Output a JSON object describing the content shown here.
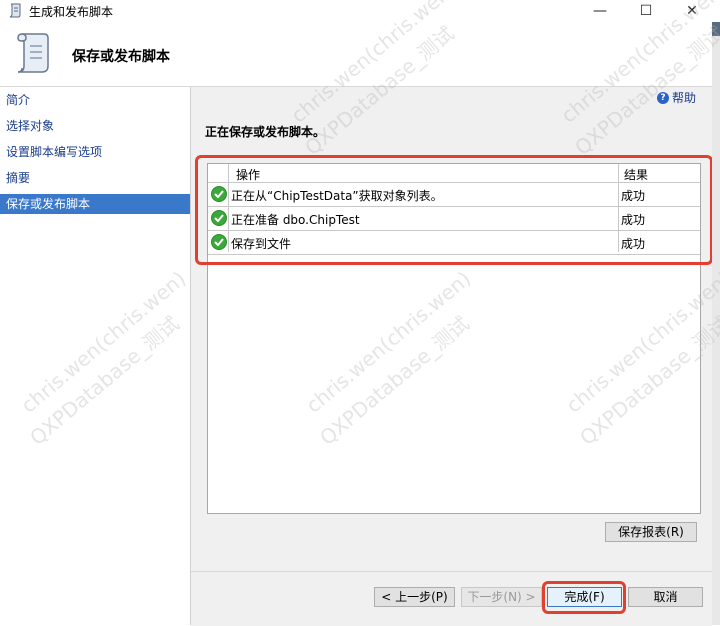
{
  "window": {
    "title": "生成和发布脚本",
    "minimize_glyph": "—",
    "maximize_glyph": "☐",
    "close_glyph": "✕"
  },
  "header": {
    "title": "保存或发布脚本"
  },
  "sidebar": {
    "items": [
      {
        "label": "简介",
        "active": false
      },
      {
        "label": "选择对象",
        "active": false
      },
      {
        "label": "设置脚本编写选项",
        "active": false
      },
      {
        "label": "摘要",
        "active": false
      },
      {
        "label": "保存或发布脚本",
        "active": true
      }
    ]
  },
  "main": {
    "help_label": "帮助",
    "status_heading": "正在保存或发布脚本。",
    "columns": {
      "operation": "操作",
      "result": "结果"
    },
    "rows": [
      {
        "operation": "正在从“ChipTestData”获取对象列表。",
        "result": "成功"
      },
      {
        "operation": "正在准备 dbo.ChipTest",
        "result": "成功"
      },
      {
        "operation": "保存到文件",
        "result": "成功"
      }
    ],
    "save_report_label": "保存报表(R)"
  },
  "footer": {
    "prev_label": "< 上一步(P)",
    "next_label": "下一步(N) >",
    "finish_label": "完成(F)",
    "cancel_label": "取消"
  },
  "watermark": {
    "line1": "chris.wen(chris.wen)",
    "line2": "QXPDatabase_测试"
  },
  "colors": {
    "accent": "#3a78c9",
    "annotation_red": "#e04030",
    "success_green": "#3aa83a"
  }
}
